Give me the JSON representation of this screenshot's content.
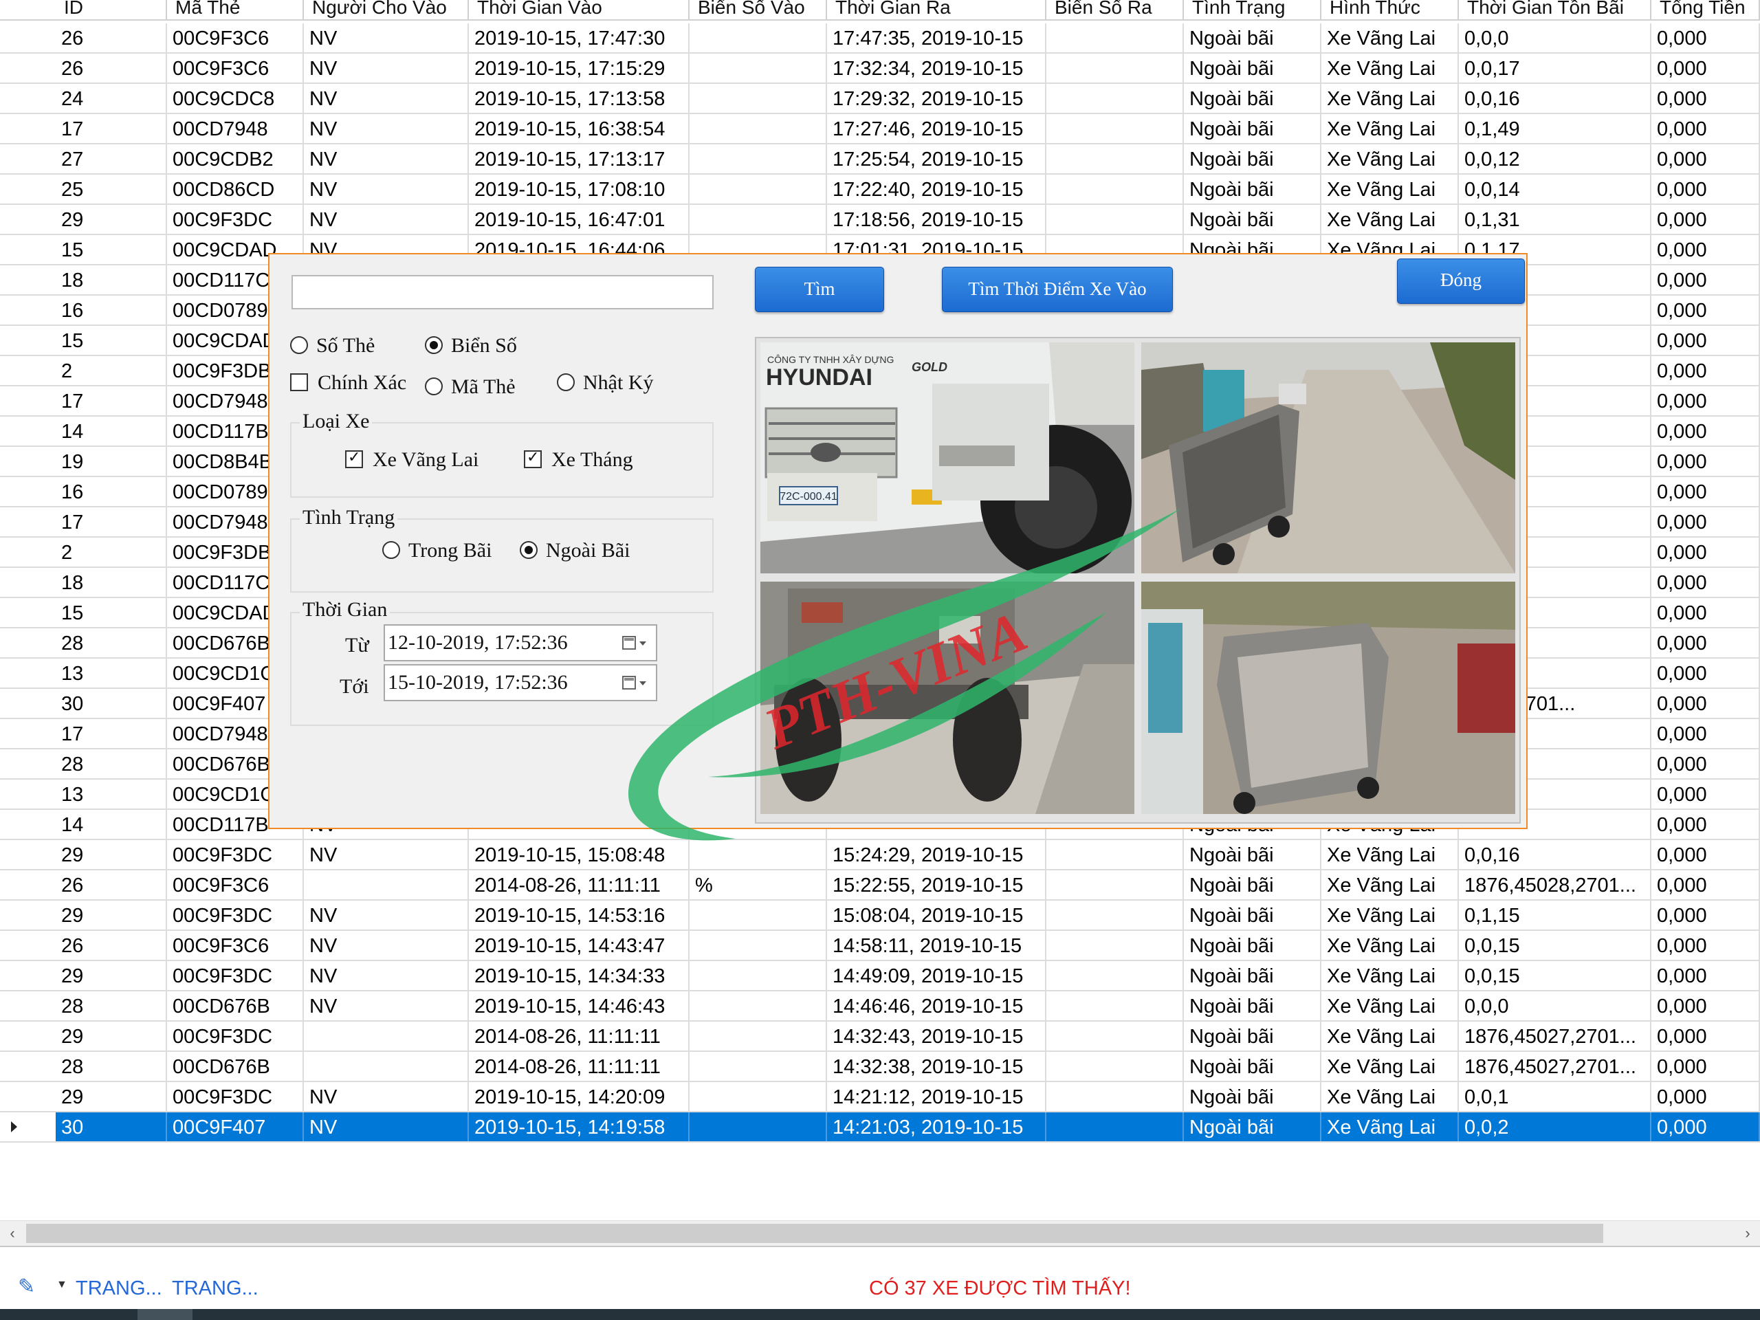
{
  "grid": {
    "headers": [
      "ID",
      "Mã Thẻ",
      "Người Cho Vào",
      "Thời Gian Vào",
      "Biển Số Vào",
      "Thời Gian Ra",
      "Biển Số Ra",
      "Tình Trạng",
      "Hình Thức",
      "Thời Gian Tồn Bãi",
      "Tổng Tiền"
    ],
    "rows": [
      [
        "26",
        "00C9F3C6",
        "NV",
        "2019-10-15, 17:47:30",
        "",
        "17:47:35, 2019-10-15",
        "",
        "Ngoài bãi",
        "Xe Vãng Lai",
        "0,0,0",
        "0,000"
      ],
      [
        "26",
        "00C9F3C6",
        "NV",
        "2019-10-15, 17:15:29",
        "",
        "17:32:34, 2019-10-15",
        "",
        "Ngoài bãi",
        "Xe Vãng Lai",
        "0,0,17",
        "0,000"
      ],
      [
        "24",
        "00C9CDC8",
        "NV",
        "2019-10-15, 17:13:58",
        "",
        "17:29:32, 2019-10-15",
        "",
        "Ngoài bãi",
        "Xe Vãng Lai",
        "0,0,16",
        "0,000"
      ],
      [
        "17",
        "00CD7948",
        "NV",
        "2019-10-15, 16:38:54",
        "",
        "17:27:46, 2019-10-15",
        "",
        "Ngoài bãi",
        "Xe Vãng Lai",
        "0,1,49",
        "0,000"
      ],
      [
        "27",
        "00C9CDB2",
        "NV",
        "2019-10-15, 17:13:17",
        "",
        "17:25:54, 2019-10-15",
        "",
        "Ngoài bãi",
        "Xe Vãng Lai",
        "0,0,12",
        "0,000"
      ],
      [
        "25",
        "00CD86CD",
        "NV",
        "2019-10-15, 17:08:10",
        "",
        "17:22:40, 2019-10-15",
        "",
        "Ngoài bãi",
        "Xe Vãng Lai",
        "0,0,14",
        "0,000"
      ],
      [
        "29",
        "00C9F3DC",
        "NV",
        "2019-10-15, 16:47:01",
        "",
        "17:18:56, 2019-10-15",
        "",
        "Ngoài bãi",
        "Xe Vãng Lai",
        "0,1,31",
        "0,000"
      ],
      [
        "15",
        "00C9CDAD",
        "NV",
        "2019-10-15, 16:44:06",
        "",
        "17:01:31, 2019-10-15",
        "",
        "Ngoài bãi",
        "Xe Vãng Lai",
        "0,1,17",
        "0,000"
      ],
      [
        "18",
        "00CD117C",
        "",
        "",
        "",
        "",
        "",
        "",
        "",
        "",
        "0,000"
      ],
      [
        "16",
        "00CD0789",
        "",
        "",
        "",
        "",
        "",
        "",
        "",
        "",
        "0,000"
      ],
      [
        "15",
        "00C9CDAD",
        "",
        "",
        "",
        "",
        "",
        "",
        "",
        "",
        "0,000"
      ],
      [
        "2",
        "00C9F3DB",
        "",
        "",
        "",
        "",
        "",
        "",
        "",
        "",
        "0,000"
      ],
      [
        "17",
        "00CD7948",
        "",
        "",
        "",
        "",
        "",
        "",
        "",
        "",
        "0,000"
      ],
      [
        "14",
        "00CD117B",
        "",
        "",
        "",
        "",
        "",
        "",
        "",
        "",
        "0,000"
      ],
      [
        "19",
        "00CD8B4B",
        "",
        "",
        "",
        "",
        "",
        "",
        "",
        "",
        "0,000"
      ],
      [
        "16",
        "00CD0789",
        "",
        "",
        "",
        "",
        "",
        "",
        "",
        "",
        "0,000"
      ],
      [
        "17",
        "00CD7948",
        "",
        "",
        "",
        "",
        "",
        "",
        "",
        "",
        "0,000"
      ],
      [
        "2",
        "00C9F3DB",
        "",
        "",
        "",
        "",
        "",
        "",
        "",
        "",
        "0,000"
      ],
      [
        "18",
        "00CD117C",
        "",
        "",
        "",
        "",
        "",
        "",
        "",
        "",
        "0,000"
      ],
      [
        "15",
        "00C9CDAD",
        "",
        "",
        "",
        "",
        "",
        "",
        "",
        "",
        "0,000"
      ],
      [
        "28",
        "00CD676B",
        "",
        "",
        "",
        "",
        "",
        "",
        "",
        "",
        "0,000"
      ],
      [
        "13",
        "00C9CD1C",
        "",
        "",
        "",
        "",
        "",
        "",
        "",
        "",
        "0,000"
      ],
      [
        "30",
        "00C9F407",
        "",
        "",
        "",
        "",
        "",
        "",
        "",
        "5029,2701...",
        "0,000"
      ],
      [
        "17",
        "00CD7948",
        "",
        "",
        "",
        "",
        "",
        "",
        "",
        "",
        "0,000"
      ],
      [
        "28",
        "00CD676B",
        "",
        "",
        "",
        "",
        "",
        "",
        "",
        "",
        "0,000"
      ],
      [
        "13",
        "00C9CD1C",
        "",
        "",
        "",
        "",
        "",
        "",
        "",
        "",
        "0,000"
      ],
      [
        "14",
        "00CD117B",
        "NV",
        "",
        "",
        "",
        "",
        "Ngoài bãi",
        "Xe Vãng Lai",
        "",
        "0,000"
      ],
      [
        "29",
        "00C9F3DC",
        "NV",
        "2019-10-15, 15:08:48",
        "",
        "15:24:29, 2019-10-15",
        "",
        "Ngoài bãi",
        "Xe Vãng Lai",
        "0,0,16",
        "0,000"
      ],
      [
        "26",
        "00C9F3C6",
        "",
        "2014-08-26, 11:11:11",
        "%",
        "15:22:55, 2019-10-15",
        "",
        "Ngoài bãi",
        "Xe Vãng Lai",
        "1876,45028,2701...",
        "0,000"
      ],
      [
        "29",
        "00C9F3DC",
        "NV",
        "2019-10-15, 14:53:16",
        "",
        "15:08:04, 2019-10-15",
        "",
        "Ngoài bãi",
        "Xe Vãng Lai",
        "0,1,15",
        "0,000"
      ],
      [
        "26",
        "00C9F3C6",
        "NV",
        "2019-10-15, 14:43:47",
        "",
        "14:58:11, 2019-10-15",
        "",
        "Ngoài bãi",
        "Xe Vãng Lai",
        "0,0,15",
        "0,000"
      ],
      [
        "29",
        "00C9F3DC",
        "NV",
        "2019-10-15, 14:34:33",
        "",
        "14:49:09, 2019-10-15",
        "",
        "Ngoài bãi",
        "Xe Vãng Lai",
        "0,0,15",
        "0,000"
      ],
      [
        "28",
        "00CD676B",
        "NV",
        "2019-10-15, 14:46:43",
        "",
        "14:46:46, 2019-10-15",
        "",
        "Ngoài bãi",
        "Xe Vãng Lai",
        "0,0,0",
        "0,000"
      ],
      [
        "29",
        "00C9F3DC",
        "",
        "2014-08-26, 11:11:11",
        "",
        "14:32:43, 2019-10-15",
        "",
        "Ngoài bãi",
        "Xe Vãng Lai",
        "1876,45027,2701...",
        "0,000"
      ],
      [
        "28",
        "00CD676B",
        "",
        "2014-08-26, 11:11:11",
        "",
        "14:32:38, 2019-10-15",
        "",
        "Ngoài bãi",
        "Xe Vãng Lai",
        "1876,45027,2701...",
        "0,000"
      ],
      [
        "29",
        "00C9F3DC",
        "NV",
        "2019-10-15, 14:20:09",
        "",
        "14:21:12, 2019-10-15",
        "",
        "Ngoài bãi",
        "Xe Vãng Lai",
        "0,0,1",
        "0,000"
      ],
      [
        "30",
        "00C9F407",
        "NV",
        "2019-10-15, 14:19:58",
        "",
        "14:21:03, 2019-10-15",
        "",
        "Ngoài bãi",
        "Xe Vãng Lai",
        "0,0,2",
        "0,000"
      ]
    ],
    "selected_row": 36
  },
  "status": {
    "page_prev": "TRANG...",
    "page_next": "TRANG...",
    "message": "CÓ 37 XE ĐƯỢC TÌM THẤY!"
  },
  "dialog": {
    "search_value": "",
    "btn_search": "Tìm",
    "btn_find_time": "Tìm Thời Điểm Xe Vào",
    "btn_close": "Đóng",
    "opt_card": "Số Thẻ",
    "opt_plate": "Biển Số",
    "chk_exact": "Chính Xác",
    "opt_cardcode": "Mã Thẻ",
    "opt_log": "Nhật Ký",
    "group_type": "Loại Xe",
    "chk_visitor": "Xe Vãng Lai",
    "chk_monthly": "Xe Tháng",
    "group_status": "Tình Trạng",
    "opt_inside": "Trong Bãi",
    "opt_outside": "Ngoài Bãi",
    "group_time": "Thời Gian",
    "label_from": "Từ",
    "label_to": "Tới",
    "from_value": "12-10-2019, 17:52:36",
    "to_value": "15-10-2019, 17:52:36",
    "truck_brand": "HYUNDAI",
    "truck_company": "CÔNG TY TNHH XÂY DỰNG",
    "truck_gold": "GOLD",
    "truck_plate": "72C-000.41",
    "watermark": "PTH-VINA"
  },
  "colors": {
    "selection": "#0078d7",
    "button_blue": "#1c6bd2",
    "dialog_border": "#f08a24",
    "status_red": "#e01e1e",
    "link_blue": "#2468d8",
    "watermark_green": "#2fb56b",
    "watermark_red": "#e0262c"
  }
}
